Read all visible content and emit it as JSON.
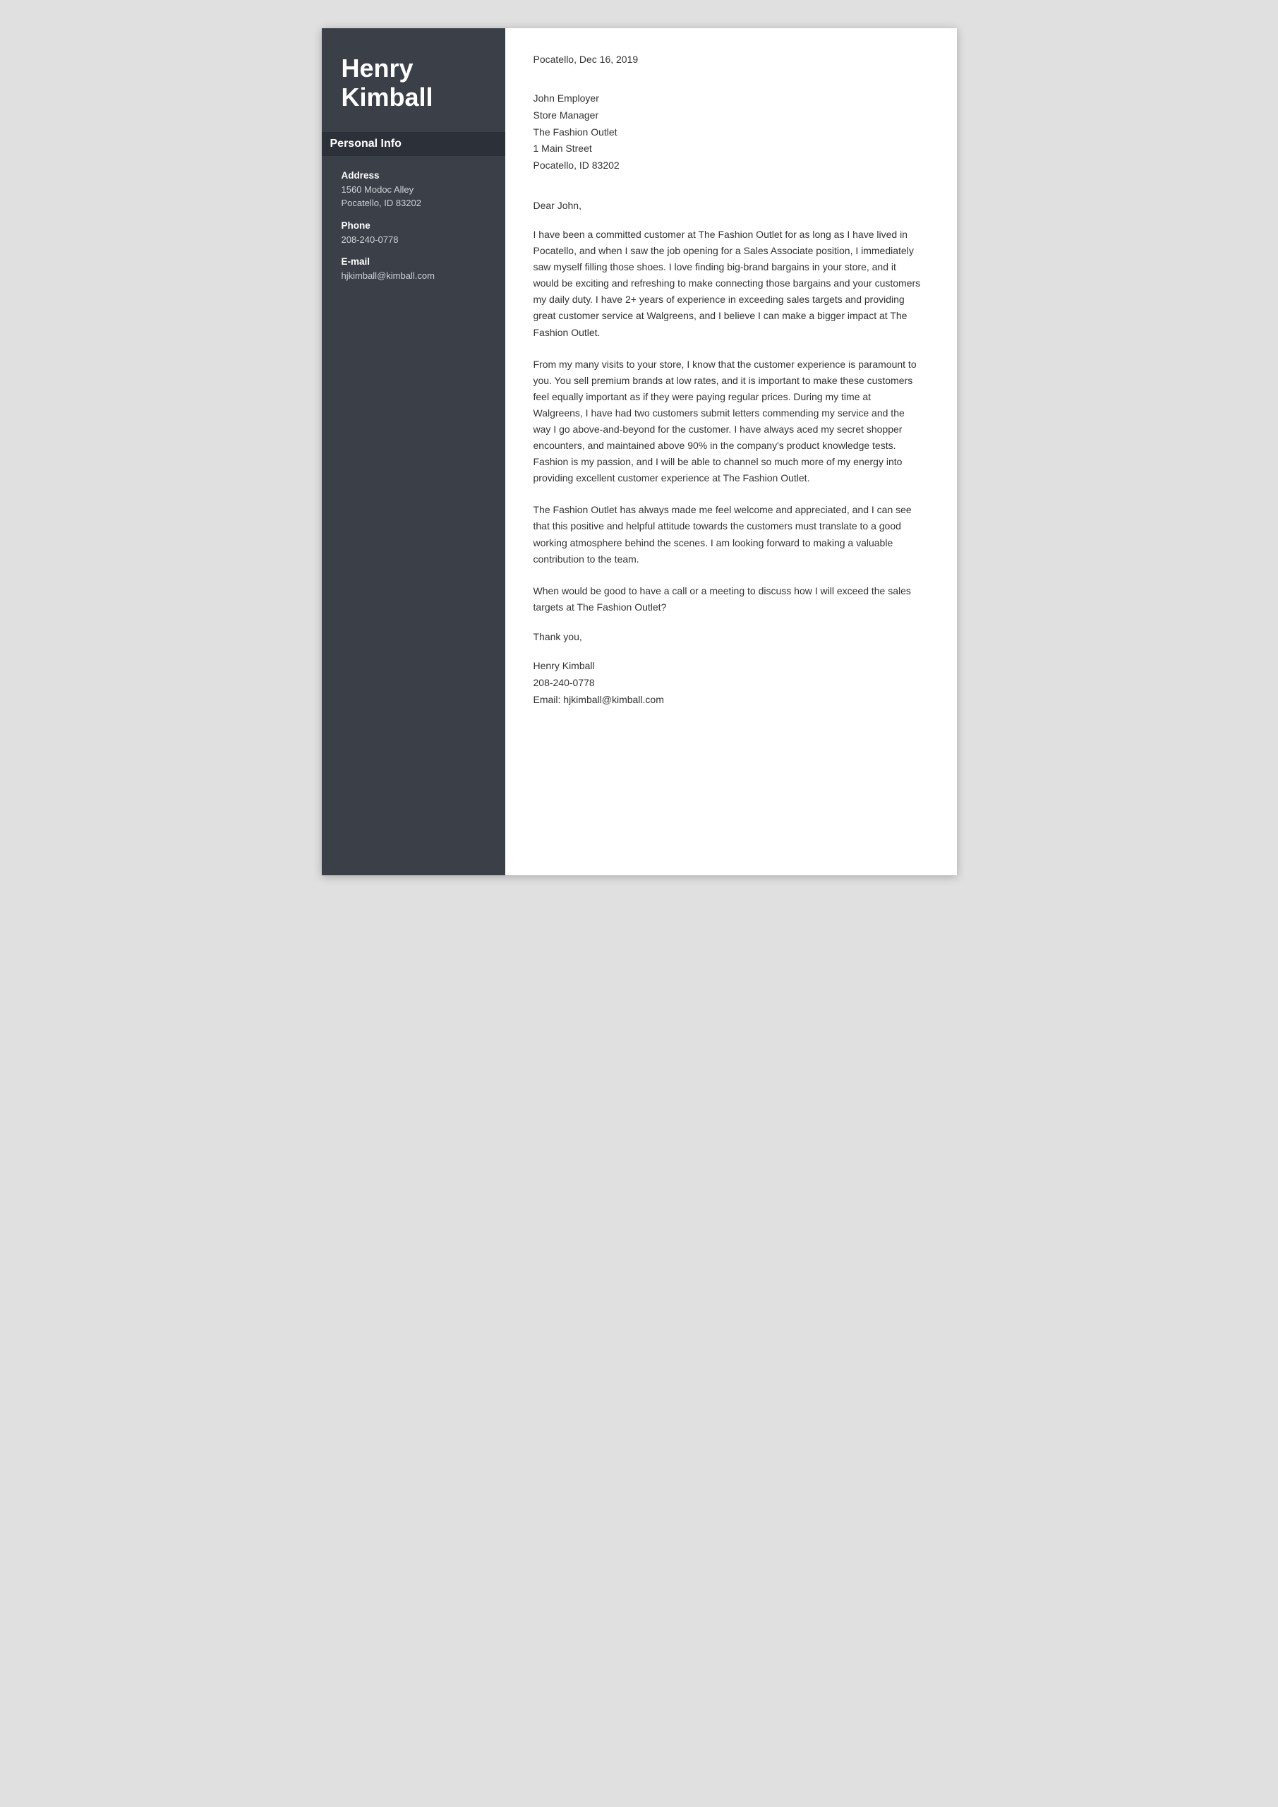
{
  "sidebar": {
    "name_line1": "Henry",
    "name_line2": "Kimball",
    "personal_info_label": "Personal Info",
    "address_label": "Address",
    "address_line1": "1560 Modoc Alley",
    "address_line2": "Pocatello, ID 83202",
    "phone_label": "Phone",
    "phone_value": "208-240-0778",
    "email_label": "E-mail",
    "email_value": "hjkimball@kimball.com"
  },
  "letter": {
    "date": "Pocatello, Dec 16, 2019",
    "recipient": {
      "name": "John Employer",
      "title": "Store Manager",
      "company": "The Fashion Outlet",
      "address1": "1 Main Street",
      "address2": "Pocatello, ID 83202"
    },
    "salutation": "Dear John,",
    "paragraphs": [
      "I have been a committed customer at The Fashion Outlet for as long as I have lived in Pocatello, and when I saw the job opening for a Sales Associate position, I immediately saw myself filling those shoes. I love finding big-brand bargains in your store, and it would be exciting and refreshing to make connecting those bargains and your customers my daily duty. I have 2+ years of experience in exceeding sales targets and providing great customer service at Walgreens, and I believe I can make a bigger impact at The Fashion Outlet.",
      "From my many visits to your store, I know that the customer experience is paramount to you. You sell premium brands at low rates, and it is important to make these customers feel equally important as if they were paying regular prices. During my time at Walgreens, I have had two customers submit letters commending my service and the way I go above-and-beyond for the customer. I have always aced my secret shopper encounters, and maintained above 90% in the company's product knowledge tests. Fashion is my passion, and I will be able to channel so much more of my energy into providing excellent customer experience at The Fashion Outlet.",
      "The Fashion Outlet has always made me feel welcome and appreciated, and I can see that this positive and helpful attitude towards the customers must translate to a good working atmosphere behind the scenes. I am looking forward to making a valuable contribution to the team.",
      "When would be good to have a call or a meeting to discuss how I will exceed the sales targets at The Fashion Outlet?"
    ],
    "thank_you": "Thank you,",
    "signature": {
      "name": "Henry Kimball",
      "phone": "208-240-0778",
      "email": "Email: hjkimball@kimball.com"
    }
  }
}
